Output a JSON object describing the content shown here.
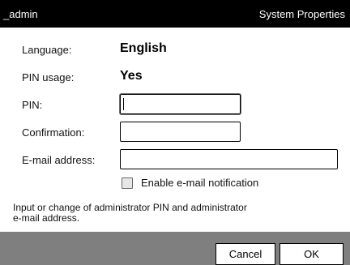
{
  "window": {
    "title_left": "_admin",
    "title_right": "System Properties"
  },
  "form": {
    "language_label": "Language:",
    "language_value": "English",
    "pin_usage_label": "PIN usage:",
    "pin_usage_value": "Yes",
    "pin_label": "PIN:",
    "pin_value": "",
    "confirmation_label": "Confirmation:",
    "confirmation_value": "",
    "email_label": "E-mail address:",
    "email_value": "",
    "enable_email_label": "Enable e-mail notification",
    "enable_email_checked": false
  },
  "help_text": "Input or change of administrator PIN and administrator e-mail address.",
  "footer": {
    "cancel_label": "Cancel",
    "ok_label": "OK"
  }
}
